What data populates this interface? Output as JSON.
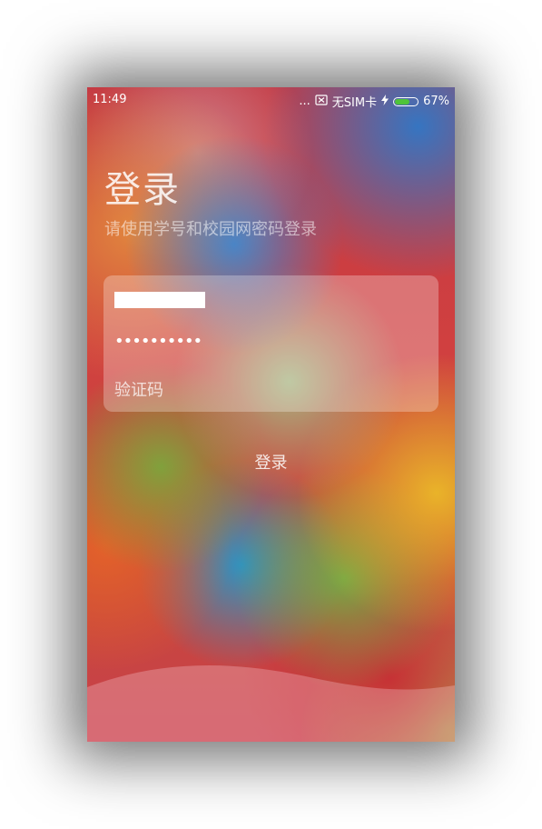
{
  "status_bar": {
    "time": "11:49",
    "dots": "...",
    "sim": "无SIM卡",
    "battery_percent": "67%",
    "battery_level": 0.67,
    "charging_icon": "bolt-icon"
  },
  "login": {
    "title": "登录",
    "subtitle": "请使用学号和校园网密码登录",
    "password_value": "••••••••••",
    "captcha_placeholder": "验证码",
    "button_label": "登录"
  }
}
